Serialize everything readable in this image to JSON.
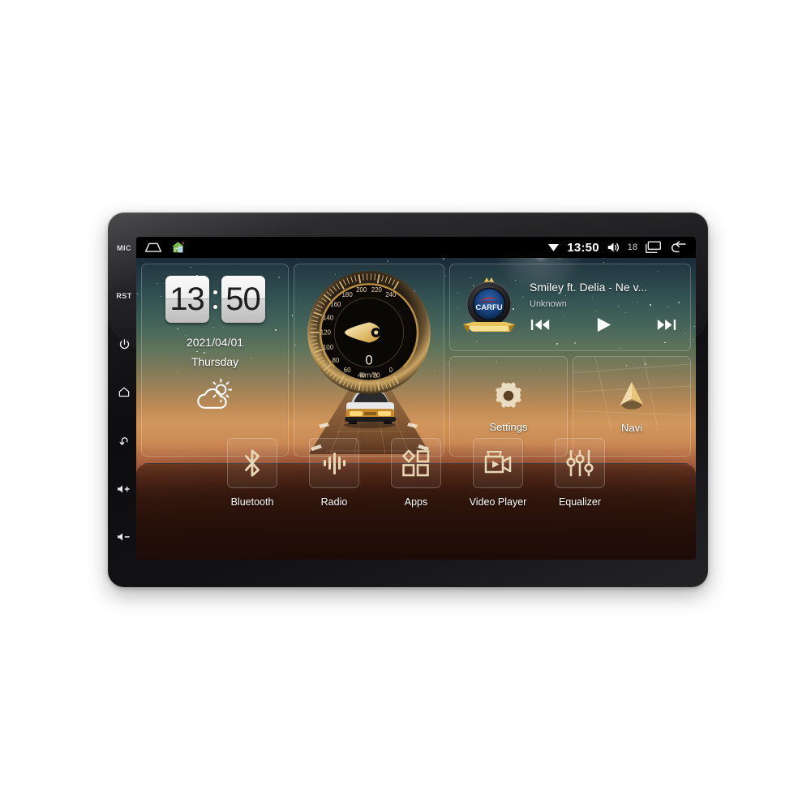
{
  "device": {
    "bezel_buttons": [
      {
        "name": "mic",
        "label": "MIC",
        "type": "text"
      },
      {
        "name": "reset",
        "label": "RST",
        "type": "text"
      },
      {
        "name": "power",
        "label": "",
        "type": "icon",
        "icon": "power-icon"
      },
      {
        "name": "home",
        "label": "",
        "type": "icon",
        "icon": "home-icon"
      },
      {
        "name": "back",
        "label": "",
        "type": "icon",
        "icon": "back-arrow-icon"
      },
      {
        "name": "volume-up",
        "label": "+",
        "type": "icon",
        "icon": "volume-up-icon"
      },
      {
        "name": "volume-down",
        "label": "-",
        "type": "icon",
        "icon": "volume-down-icon"
      }
    ]
  },
  "statusbar": {
    "left_icons": [
      {
        "name": "android-back-icon"
      },
      {
        "name": "home-house-icon"
      }
    ],
    "wifi_icon": "wifi-icon",
    "time": "13:50",
    "volume_icon": "volume-icon",
    "volume_level": "18",
    "recents_icon": "recent-apps-icon",
    "back_icon": "back-arrow-icon"
  },
  "clock_widget": {
    "hour": "13",
    "minute": "50",
    "date": "2021/04/01",
    "weekday": "Thursday",
    "weather_icon": "partly-cloudy-icon"
  },
  "speed_widget": {
    "value": "0",
    "unit": "km/h",
    "ticks": [
      "0",
      "20",
      "40",
      "60",
      "80",
      "100",
      "120",
      "140",
      "160",
      "180",
      "200",
      "220",
      "240"
    ],
    "min": 0,
    "max": 240
  },
  "music_widget": {
    "album_logo": "CARFU",
    "track_title": "Smiley ft. Delia - Ne v...",
    "artist": "Unknown",
    "controls": [
      {
        "name": "previous-track-button",
        "icon": "skip-previous-icon"
      },
      {
        "name": "play-button",
        "icon": "play-icon"
      },
      {
        "name": "next-track-button",
        "icon": "skip-next-icon"
      }
    ]
  },
  "tiles": [
    {
      "name": "settings",
      "label": "Settings",
      "icon": "gear-icon"
    },
    {
      "name": "navi",
      "label": "Navi",
      "icon": "navigation-arrow-icon"
    }
  ],
  "dock": [
    {
      "name": "bluetooth",
      "label": "Bluetooth",
      "icon": "bluetooth-icon"
    },
    {
      "name": "radio",
      "label": "Radio",
      "icon": "radio-waveform-icon"
    },
    {
      "name": "apps",
      "label": "Apps",
      "icon": "apps-grid-icon"
    },
    {
      "name": "video-player",
      "label": "Video Player",
      "icon": "video-camera-icon"
    },
    {
      "name": "equalizer",
      "label": "Equalizer",
      "icon": "equalizer-sliders-icon"
    }
  ],
  "colors": {
    "accent_gold": "#d8b97a",
    "screen_dark": "#000000",
    "text_primary": "#ffffff",
    "bezel": "#1a1a1c"
  }
}
